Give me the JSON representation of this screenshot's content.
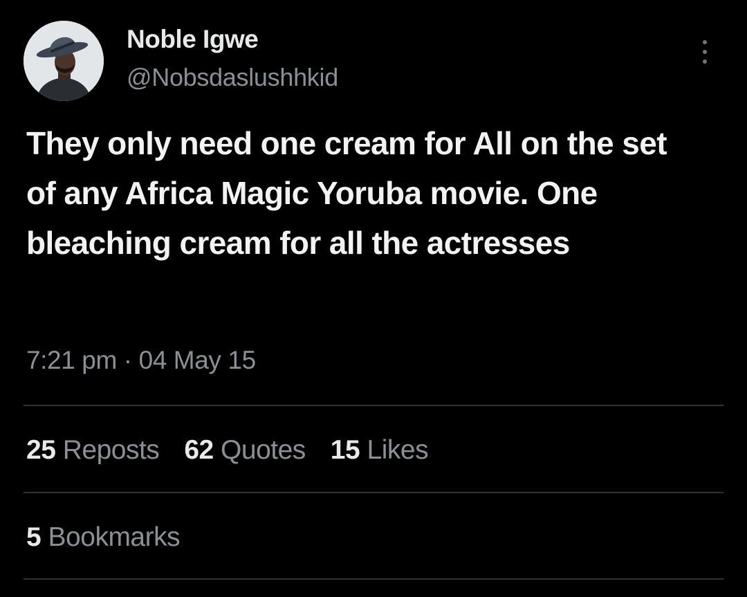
{
  "author": {
    "name": "Noble Igwe",
    "handle": "@Nobsdaslushhkid"
  },
  "tweet": {
    "text": "They only need one cream for All on the set of any Africa Magic Yoruba movie. One bleaching cream for all the actresses",
    "timestamp": "7:21 pm · 04 May 15"
  },
  "stats": {
    "reposts": {
      "count": "25",
      "label": "Reposts"
    },
    "quotes": {
      "count": "62",
      "label": "Quotes"
    },
    "likes": {
      "count": "15",
      "label": "Likes"
    },
    "bookmarks": {
      "count": "5",
      "label": "Bookmarks"
    }
  },
  "icons": {
    "more": "more-options-icon"
  },
  "colors": {
    "background": "#000000",
    "primary_text": "#e7e9ea",
    "secondary_text": "#8b9096",
    "divider": "#2f3336"
  }
}
